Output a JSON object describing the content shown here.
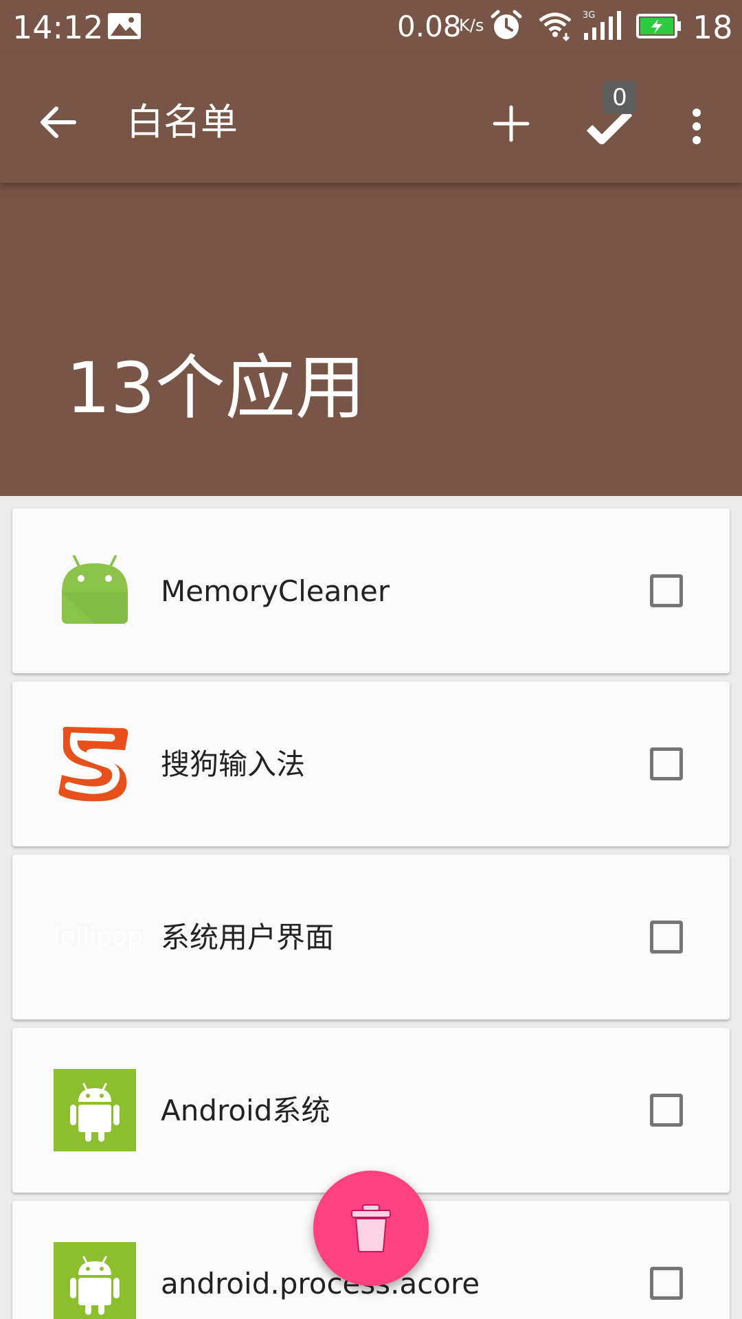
{
  "status_bar": {
    "time": "14:12",
    "net_speed": "0.08",
    "net_unit": "K/s",
    "battery_level": "18",
    "icons": [
      "gallery-icon",
      "alarm-icon",
      "wifi-icon",
      "signal-3g-icon",
      "battery-charging-icon"
    ]
  },
  "app_bar": {
    "title": "白名单",
    "badge_count": "0",
    "icons": [
      "back-arrow-icon",
      "add-icon",
      "check-icon",
      "more-vert-icon"
    ]
  },
  "header": {
    "count_text": "13个应用"
  },
  "apps": [
    {
      "name": "MemoryCleaner",
      "icon": "android-robot-icon",
      "checked": false
    },
    {
      "name": "搜狗输入法",
      "icon": "sogou-icon",
      "checked": false
    },
    {
      "name": "系统用户界面",
      "icon": "lollipop-icon",
      "icon_text": "lollipop",
      "checked": false
    },
    {
      "name": "Android系统",
      "icon": "android-system-icon",
      "checked": false
    },
    {
      "name": "android.process.acore",
      "icon": "android-system-icon",
      "checked": false
    }
  ],
  "fab": {
    "icon": "trash-icon"
  },
  "colors": {
    "primary": "#795548",
    "accent": "#ff4081",
    "card": "#fafafa",
    "android_green": "#8bc34a"
  }
}
